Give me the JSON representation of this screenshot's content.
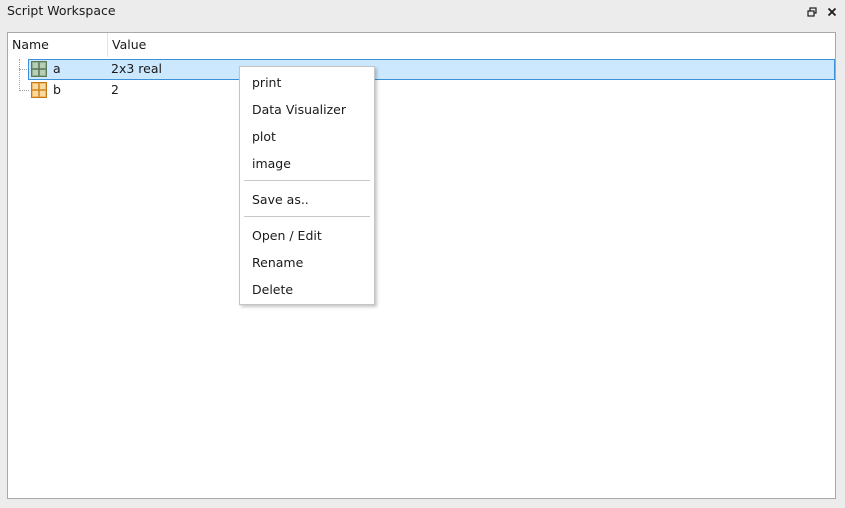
{
  "panel": {
    "title": "Script Workspace",
    "restore_icon": "restore-icon",
    "close_icon": "close-icon"
  },
  "table": {
    "columns": [
      "Name",
      "Value"
    ],
    "rows": [
      {
        "name": "a",
        "value": "2x3 real",
        "icon": "matrix-icon-green",
        "selected": true
      },
      {
        "name": "b",
        "value": "2",
        "icon": "matrix-icon-orange",
        "selected": false
      }
    ]
  },
  "context_menu": {
    "items": [
      {
        "label": "print"
      },
      {
        "label": "Data Visualizer"
      },
      {
        "label": "plot"
      },
      {
        "label": "image"
      },
      {
        "label": "Save as.."
      },
      {
        "label": "Open / Edit"
      },
      {
        "label": "Rename"
      },
      {
        "label": "Delete"
      }
    ]
  },
  "colors": {
    "selection_bg": "#cce8ff",
    "selection_border": "#3d8fd6",
    "variable_a_icon": "#6b8e6b",
    "variable_b_icon": "#e8a33d"
  }
}
